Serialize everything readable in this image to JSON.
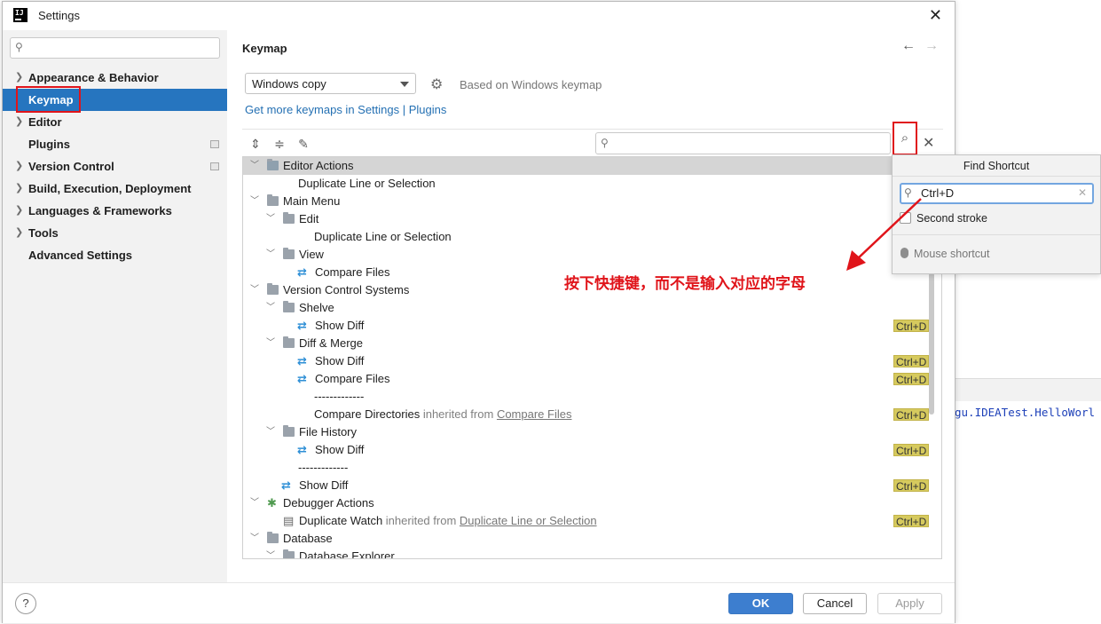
{
  "window": {
    "title": "Settings"
  },
  "background": {
    "code_text": "gu.IDEATest.HelloWorl"
  },
  "sidebar": {
    "search_placeholder": "",
    "items": [
      {
        "label": "Appearance & Behavior",
        "chevron": true,
        "badge": false
      },
      {
        "label": "Keymap",
        "chevron": false,
        "badge": false,
        "selected": true
      },
      {
        "label": "Editor",
        "chevron": true,
        "badge": false
      },
      {
        "label": "Plugins",
        "chevron": false,
        "badge": true
      },
      {
        "label": "Version Control",
        "chevron": true,
        "badge": true
      },
      {
        "label": "Build, Execution, Deployment",
        "chevron": true,
        "badge": false
      },
      {
        "label": "Languages & Frameworks",
        "chevron": true,
        "badge": false
      },
      {
        "label": "Tools",
        "chevron": true,
        "badge": false
      },
      {
        "label": "Advanced Settings",
        "chevron": false,
        "badge": false
      }
    ]
  },
  "main": {
    "title": "Keymap",
    "keymap_value": "Windows copy",
    "based_on": "Based on Windows keymap",
    "link_prefix": "Get more keymaps in Settings | Plugins",
    "search_value": ""
  },
  "tree": {
    "rows": [
      {
        "level": 0,
        "chev": "expanded",
        "icon": "editor-actions-icon",
        "label": "Editor Actions",
        "highlight": true,
        "shortcut": ""
      },
      {
        "level": 1,
        "chev": "none",
        "icon": "none",
        "label": "Duplicate Line or Selection",
        "shortcut": ""
      },
      {
        "level": 0,
        "chev": "expanded",
        "icon": "main-menu-icon",
        "label": "Main Menu",
        "shortcut": ""
      },
      {
        "level": 1,
        "chev": "expanded",
        "icon": "folder-icon",
        "label": "Edit",
        "shortcut": ""
      },
      {
        "level": 2,
        "chev": "none",
        "icon": "none",
        "label": "Duplicate Line or Selection",
        "shortcut": ""
      },
      {
        "level": 1,
        "chev": "expanded",
        "icon": "folder-icon",
        "label": "View",
        "shortcut": ""
      },
      {
        "level": 2,
        "chev": "none",
        "icon": "diff-icon",
        "label": "Compare Files",
        "shortcut": ""
      },
      {
        "level": 0,
        "chev": "expanded",
        "icon": "folder-icon",
        "label": "Version Control Systems",
        "shortcut": ""
      },
      {
        "level": 1,
        "chev": "expanded",
        "icon": "folder-icon",
        "label": "Shelve",
        "shortcut": ""
      },
      {
        "level": 2,
        "chev": "none",
        "icon": "diff-icon",
        "label": "Show Diff",
        "shortcut": "Ctrl+D"
      },
      {
        "level": 1,
        "chev": "expanded",
        "icon": "folder-icon",
        "label": "Diff & Merge",
        "shortcut": ""
      },
      {
        "level": 2,
        "chev": "none",
        "icon": "diff-icon",
        "label": "Show Diff",
        "shortcut": "Ctrl+D"
      },
      {
        "level": 2,
        "chev": "none",
        "icon": "diff-icon",
        "label": "Compare Files",
        "shortcut": "Ctrl+D"
      },
      {
        "level": 2,
        "chev": "none",
        "icon": "none",
        "label": "-------------",
        "shortcut": ""
      },
      {
        "level": 2,
        "chev": "none",
        "icon": "none",
        "label": "Compare Directories",
        "inherited": "inherited from",
        "ref": "Compare Files",
        "shortcut": "Ctrl+D"
      },
      {
        "level": 1,
        "chev": "expanded",
        "icon": "folder-icon",
        "label": "File History",
        "shortcut": ""
      },
      {
        "level": 2,
        "chev": "none",
        "icon": "diff-icon",
        "label": "Show Diff",
        "shortcut": "Ctrl+D"
      },
      {
        "level": 1,
        "chev": "none",
        "icon": "none",
        "label": "-------------",
        "shortcut": ""
      },
      {
        "level": 1,
        "chev": "none",
        "icon": "diff-icon",
        "label": "Show Diff",
        "shortcut": "Ctrl+D"
      },
      {
        "level": 0,
        "chev": "expanded",
        "icon": "bug-icon",
        "label": "Debugger Actions",
        "shortcut": ""
      },
      {
        "level": 1,
        "chev": "none",
        "icon": "watch-icon",
        "label": "Duplicate Watch",
        "inherited": "inherited from",
        "ref": "Duplicate Line or Selection",
        "shortcut": "Ctrl+D"
      },
      {
        "level": 0,
        "chev": "expanded",
        "icon": "folder-icon",
        "label": "Database",
        "shortcut": ""
      },
      {
        "level": 1,
        "chev": "expanded",
        "icon": "folder-icon",
        "label": "Database Explorer",
        "shortcut": ""
      }
    ]
  },
  "find_shortcut": {
    "title": "Find Shortcut",
    "value": "Ctrl+D",
    "second_stroke": "Second stroke",
    "mouse_shortcut": "Mouse shortcut"
  },
  "annotation": {
    "text": "按下快捷键，而不是输入对应的字母",
    "color": "#e0141a"
  },
  "footer": {
    "ok": "OK",
    "cancel": "Cancel",
    "apply": "Apply",
    "help": "?"
  },
  "colors": {
    "selection": "#2675bf",
    "shortcut_badge": "#d6ca5e",
    "link": "#2470b3",
    "primary_button": "#3d7ecf"
  }
}
